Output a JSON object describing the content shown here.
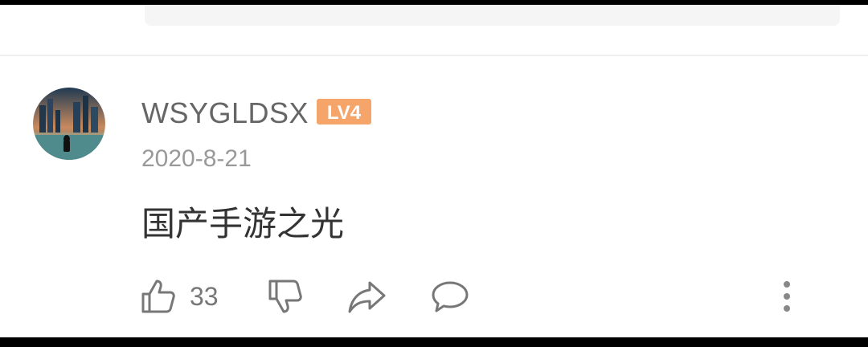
{
  "comment": {
    "username": "WSYGLDSX",
    "level": "LV4",
    "date": "2020-8-21",
    "text": "国产手游之光",
    "like_count": "33"
  },
  "colors": {
    "level_badge": "#f5a46a",
    "text_primary": "#333333",
    "text_secondary": "#666666",
    "text_muted": "#999999"
  },
  "icons": {
    "like": "thumbs-up-icon",
    "dislike": "thumbs-down-icon",
    "share": "share-arrow-icon",
    "reply": "speech-bubble-icon",
    "more": "vertical-ellipsis-icon"
  }
}
